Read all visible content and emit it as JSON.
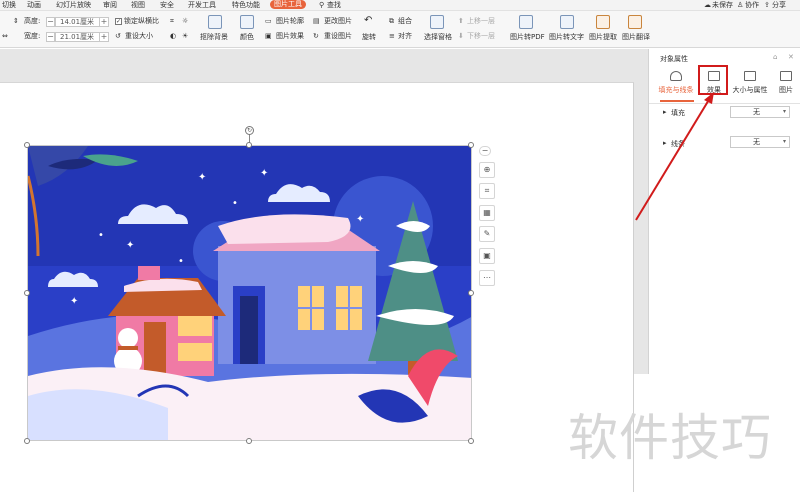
{
  "menu": {
    "items": [
      "切换",
      "动画",
      "幻灯片放映",
      "审阅",
      "视图",
      "安全",
      "开发工具",
      "特色功能"
    ],
    "active_tab": "图片工具",
    "search": "查找",
    "right": [
      "未保存",
      "协作",
      "分享"
    ]
  },
  "ribbon": {
    "height_label": "高度:",
    "height_value": "14.01厘米",
    "width_label": "宽度:",
    "width_value": "21.01厘米",
    "lock_ratio": "锁定纵横比",
    "reset_size": "重设大小",
    "remove_bg": "抠除背景",
    "color": "颜色",
    "outline": "图片轮廓",
    "effect": "图片效果",
    "change_pic": "更改图片",
    "reset_pic": "重设图片",
    "combine": "组合",
    "rotate": "旋转",
    "align": "对齐",
    "selection_pane": "选择窗格",
    "up_layer": "上移一层",
    "down_layer": "下移一层",
    "to_pdf": "图片转PDF",
    "to_text": "图片转文字",
    "extract": "图片提取",
    "translate": "图片翻译"
  },
  "panel": {
    "title": "对象属性",
    "tabs": [
      "填充与线条",
      "效果",
      "大小与属性",
      "图片"
    ],
    "fill_label": "填充",
    "line_label": "线条",
    "fill_value": "无",
    "line_value": "无"
  },
  "watermark": "软件技巧",
  "colors": {
    "accent": "#e8643c",
    "highlight": "#d11b1b",
    "sky": "#2a3fc7"
  }
}
